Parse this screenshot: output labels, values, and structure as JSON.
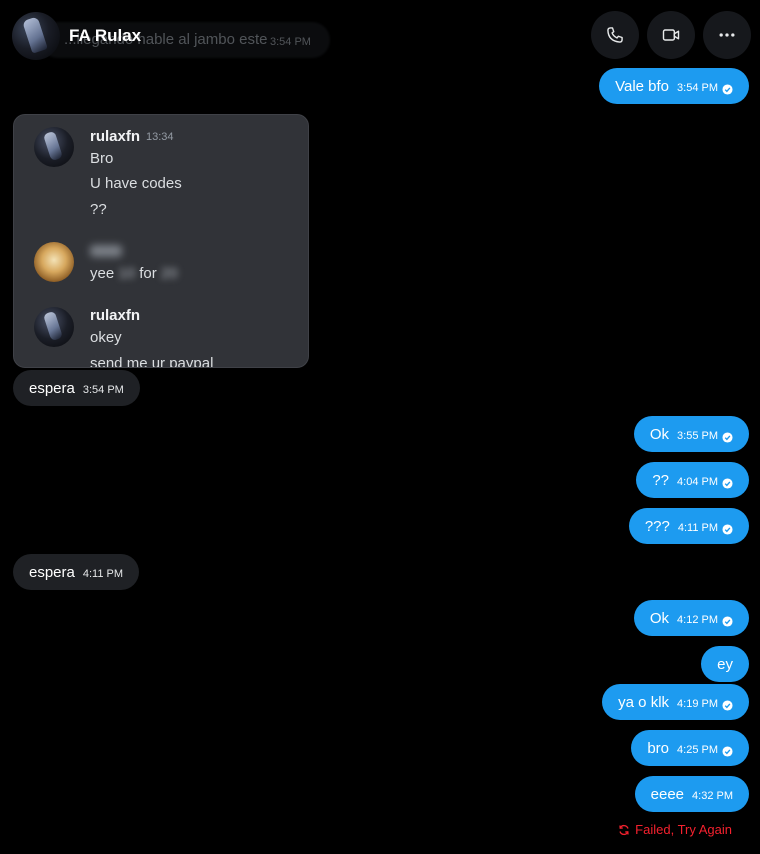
{
  "header": {
    "contact_name": "FA Rulax",
    "ghost_message": "...llegando hable al jambo este",
    "ghost_time": "3:54 PM",
    "call_icon": "phone-icon",
    "video_icon": "video-icon",
    "more_icon": "more-icon"
  },
  "messages": [
    {
      "text": "Vale bfo",
      "time": "3:54 PM"
    },
    {
      "text": "espera",
      "time": "3:54 PM"
    },
    {
      "text": "Ok",
      "time": "3:55 PM"
    },
    {
      "text": "??",
      "time": "4:04 PM"
    },
    {
      "text": "???",
      "time": "4:11 PM"
    },
    {
      "text": "espera",
      "time": "4:11 PM"
    },
    {
      "text": "Ok",
      "time": "4:12 PM"
    },
    {
      "text": "ey",
      "time": ""
    },
    {
      "text": "ya o klk",
      "time": "4:19 PM"
    },
    {
      "text": "bro",
      "time": "4:25 PM"
    },
    {
      "text": "eeee",
      "time": "4:32 PM"
    }
  ],
  "failed_label": "Failed, Try Again",
  "screenshot": {
    "user1": "rulaxfn",
    "time1": "13:34",
    "lines1": [
      "Bro",
      "U have codes",
      "??"
    ],
    "line2": "yee",
    "line2_hidden1": "10",
    "line2_mid": "for",
    "line2_hidden2": "20",
    "user3": "rulaxfn",
    "lines3": [
      "okey",
      "send me ur paypal"
    ]
  },
  "colors": {
    "outgoing_bubble": "#1d9bf0",
    "incoming_bubble": "#1f2125",
    "failed": "#f4212e"
  }
}
